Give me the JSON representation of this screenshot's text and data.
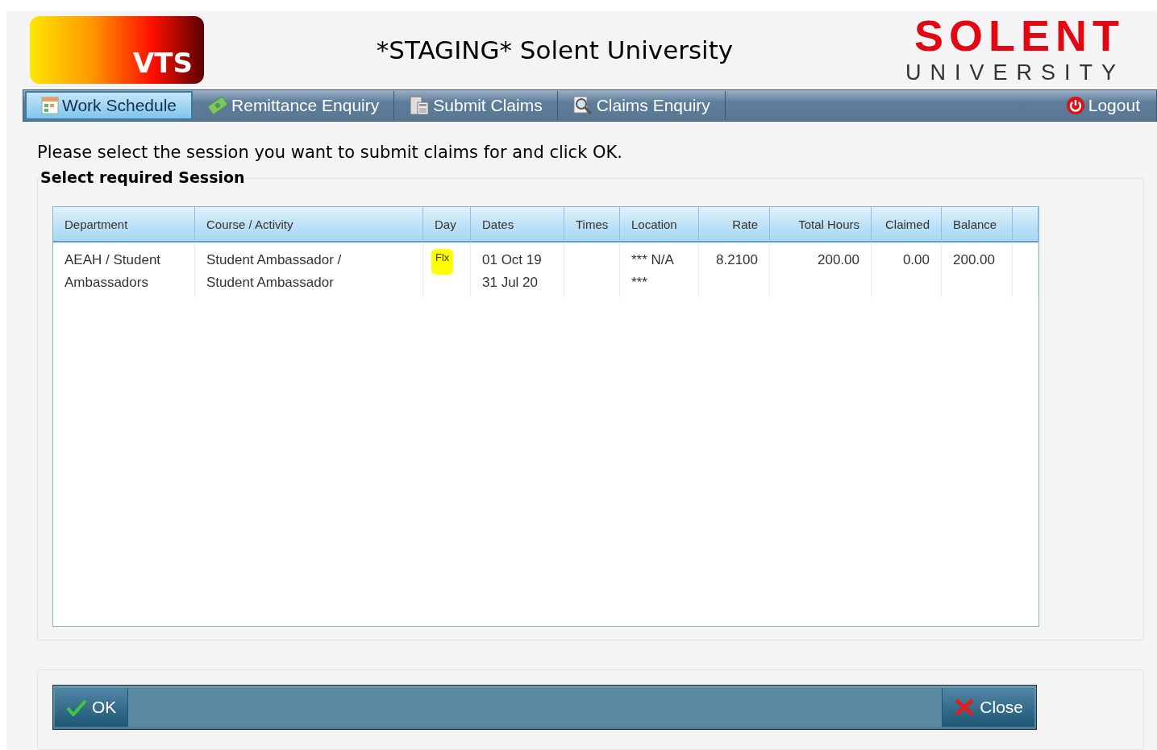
{
  "header": {
    "logo_text": "VTS",
    "title": "*STAGING* Solent University",
    "brand": {
      "name": "SOLENT",
      "subtitle": "UNIVERSITY"
    }
  },
  "nav": {
    "tabs": [
      {
        "label": "Work Schedule",
        "selected": true
      },
      {
        "label": "Remittance Enquiry",
        "selected": false
      },
      {
        "label": "Submit Claims",
        "selected": false
      },
      {
        "label": "Claims Enquiry",
        "selected": false
      }
    ],
    "logout": "Logout"
  },
  "instruction": "Please select the session you want to submit claims for and click OK.",
  "group_title": "Select required Session",
  "table": {
    "columns": [
      "Department",
      "Course / Activity",
      "Day",
      "Dates",
      "Times",
      "Location",
      "Rate",
      "Total Hours",
      "Claimed",
      "Balance"
    ],
    "rows": [
      {
        "cells": [
          {
            "lines": [
              "AEAH / Student",
              "Ambassadors"
            ]
          },
          {
            "lines": [
              "Student Ambassador /",
              "Student Ambassador"
            ]
          },
          {
            "lines": [
              "Flx"
            ],
            "highlighted": true
          },
          {
            "lines": [
              "01 Oct 19",
              "31 Jul 20"
            ]
          },
          {},
          {
            "lines": [
              "*** N/A",
              "***"
            ]
          },
          {
            "lines": [
              "8.2100"
            ]
          },
          {
            "lines": [
              "200.00"
            ]
          },
          {
            "lines": [
              "0.00"
            ]
          },
          {
            "lines": [
              "200.00"
            ]
          }
        ]
      }
    ]
  },
  "buttons": {
    "ok": "OK",
    "close": "Close"
  }
}
